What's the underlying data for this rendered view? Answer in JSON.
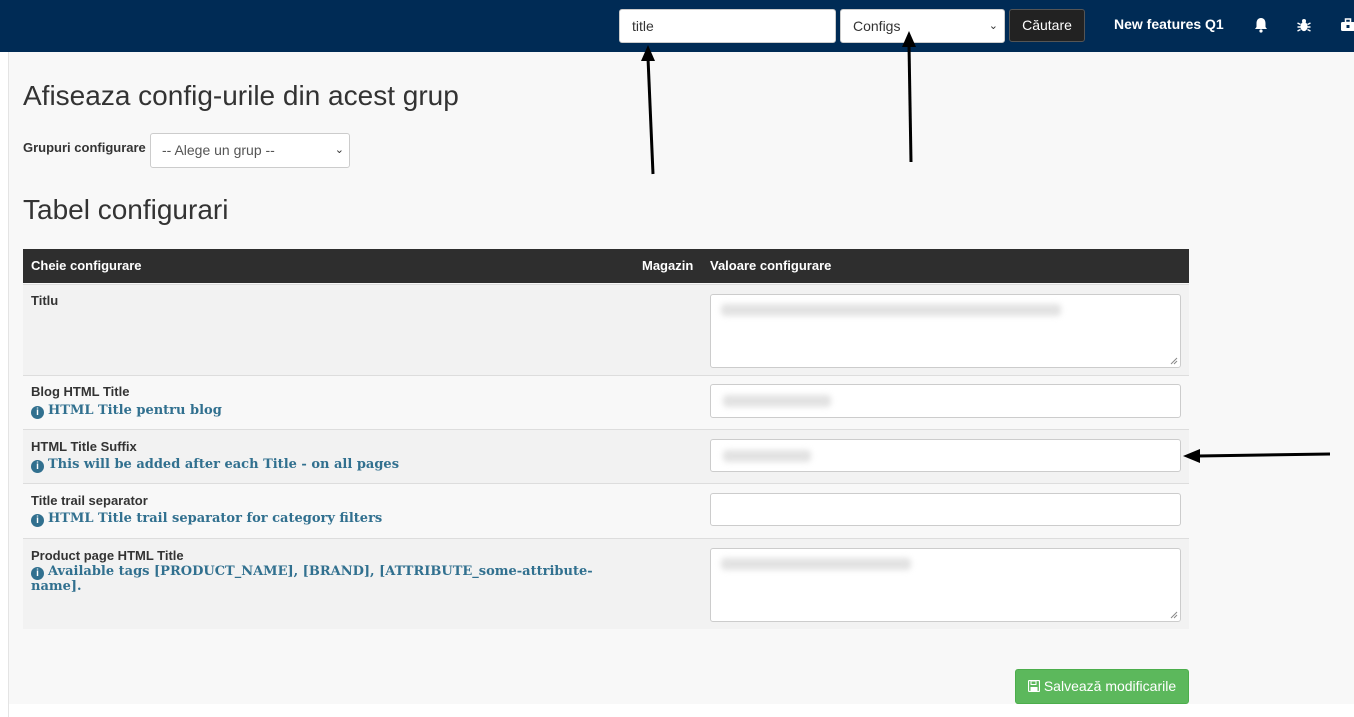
{
  "topbar": {
    "search_value": "title",
    "scope_selected": "Configs",
    "search_button_label": "Căutare",
    "nav_link_label": "New features Q1"
  },
  "page": {
    "group_section_title": "Afiseaza config-urile din acest grup",
    "group_label": "Grupuri configurare",
    "group_select_placeholder": "-- Alege un grup --",
    "table_title": "Tabel configurari"
  },
  "table": {
    "columns": [
      "Cheie configurare",
      "Magazin",
      "Valoare configurare"
    ],
    "rows": [
      {
        "key": "Titlu",
        "hint": ""
      },
      {
        "key": "Blog HTML Title",
        "hint": "HTML Title pentru blog"
      },
      {
        "key": "HTML Title Suffix",
        "hint": "This will be added after each Title - on all pages"
      },
      {
        "key": "Title trail separator",
        "hint": "HTML Title trail separator for category filters"
      },
      {
        "key": "Product page HTML Title",
        "hint": "Available tags [PRODUCT_NAME], [BRAND], [ATTRIBUTE_some-attribute-name]."
      }
    ]
  },
  "actions": {
    "save_label": "Salvează modificarile"
  },
  "icons": {
    "info": "info-circle-icon",
    "bell": "bell-icon",
    "bug": "bug-icon",
    "toolbox": "toolbox-icon",
    "save": "floppy-disk-icon"
  },
  "colors": {
    "topbar": "#002b55",
    "hint_text": "#31708f",
    "save_button": "#5cb85c",
    "table_header": "#2e2e2e"
  }
}
